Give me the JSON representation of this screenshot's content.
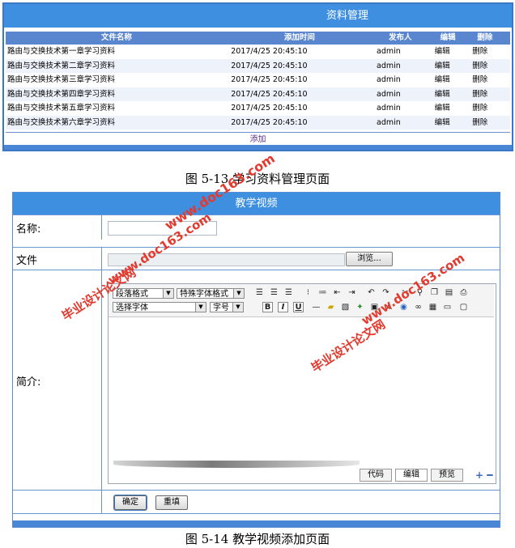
{
  "fig1": {
    "title": "资料管理",
    "headers": {
      "name": "文件名称",
      "time": "添加时间",
      "publisher": "发布人",
      "edit": "编辑",
      "delete": "删除"
    },
    "rows": [
      {
        "name": "路由与交换技术第一章学习资料",
        "time": "2017/4/25 20:45:10",
        "publisher": "admin",
        "edit": "编辑",
        "delete": "删除"
      },
      {
        "name": "路由与交换技术第二章学习资料",
        "time": "2017/4/25 20:45:10",
        "publisher": "admin",
        "edit": "编辑",
        "delete": "删除"
      },
      {
        "name": "路由与交换技术第三章学习资料",
        "time": "2017/4/25 20:45:10",
        "publisher": "admin",
        "edit": "编辑",
        "delete": "删除"
      },
      {
        "name": "路由与交换技术第四章学习资料",
        "time": "2017/4/25 20:45:10",
        "publisher": "admin",
        "edit": "编辑",
        "delete": "删除"
      },
      {
        "name": "路由与交换技术第五章学习资料",
        "time": "2017/4/25 20:45:10",
        "publisher": "admin",
        "edit": "编辑",
        "delete": "删除"
      },
      {
        "name": "路由与交换技术第六章学习资料",
        "time": "2017/4/25 20:45:10",
        "publisher": "admin",
        "edit": "编辑",
        "delete": "删除"
      }
    ],
    "add_label": "添加",
    "caption": "图 5-13 学习资料管理页面"
  },
  "fig2": {
    "title": "教学视频",
    "name_label": "名称:",
    "file_label": "文件",
    "browse_label": "浏览...",
    "intro_label": "简介:",
    "toolbar": {
      "paragraph_format": "段落格式",
      "special_font": "特殊字体格式",
      "select_font": "选择字体",
      "font_size": "字号",
      "bold": "B",
      "italic": "I",
      "underline": "U"
    },
    "mode_tabs": {
      "code": "代码",
      "edit": "编辑",
      "preview": "预览"
    },
    "ok_label": "确定",
    "reset_label": "重填",
    "caption": "图 5-14 教学视频添加页面"
  },
  "watermarks": {
    "site1": "www.doc163.com",
    "text1": "毕业设计论文网",
    "site2": "www.doc163.com",
    "text2": "毕业设计论文网",
    "site3": "www.doc163.com"
  },
  "colors": {
    "header_blue": "#3f8fe0",
    "table_head": "#5a86cf",
    "watermark_red": "#e23a2e"
  }
}
